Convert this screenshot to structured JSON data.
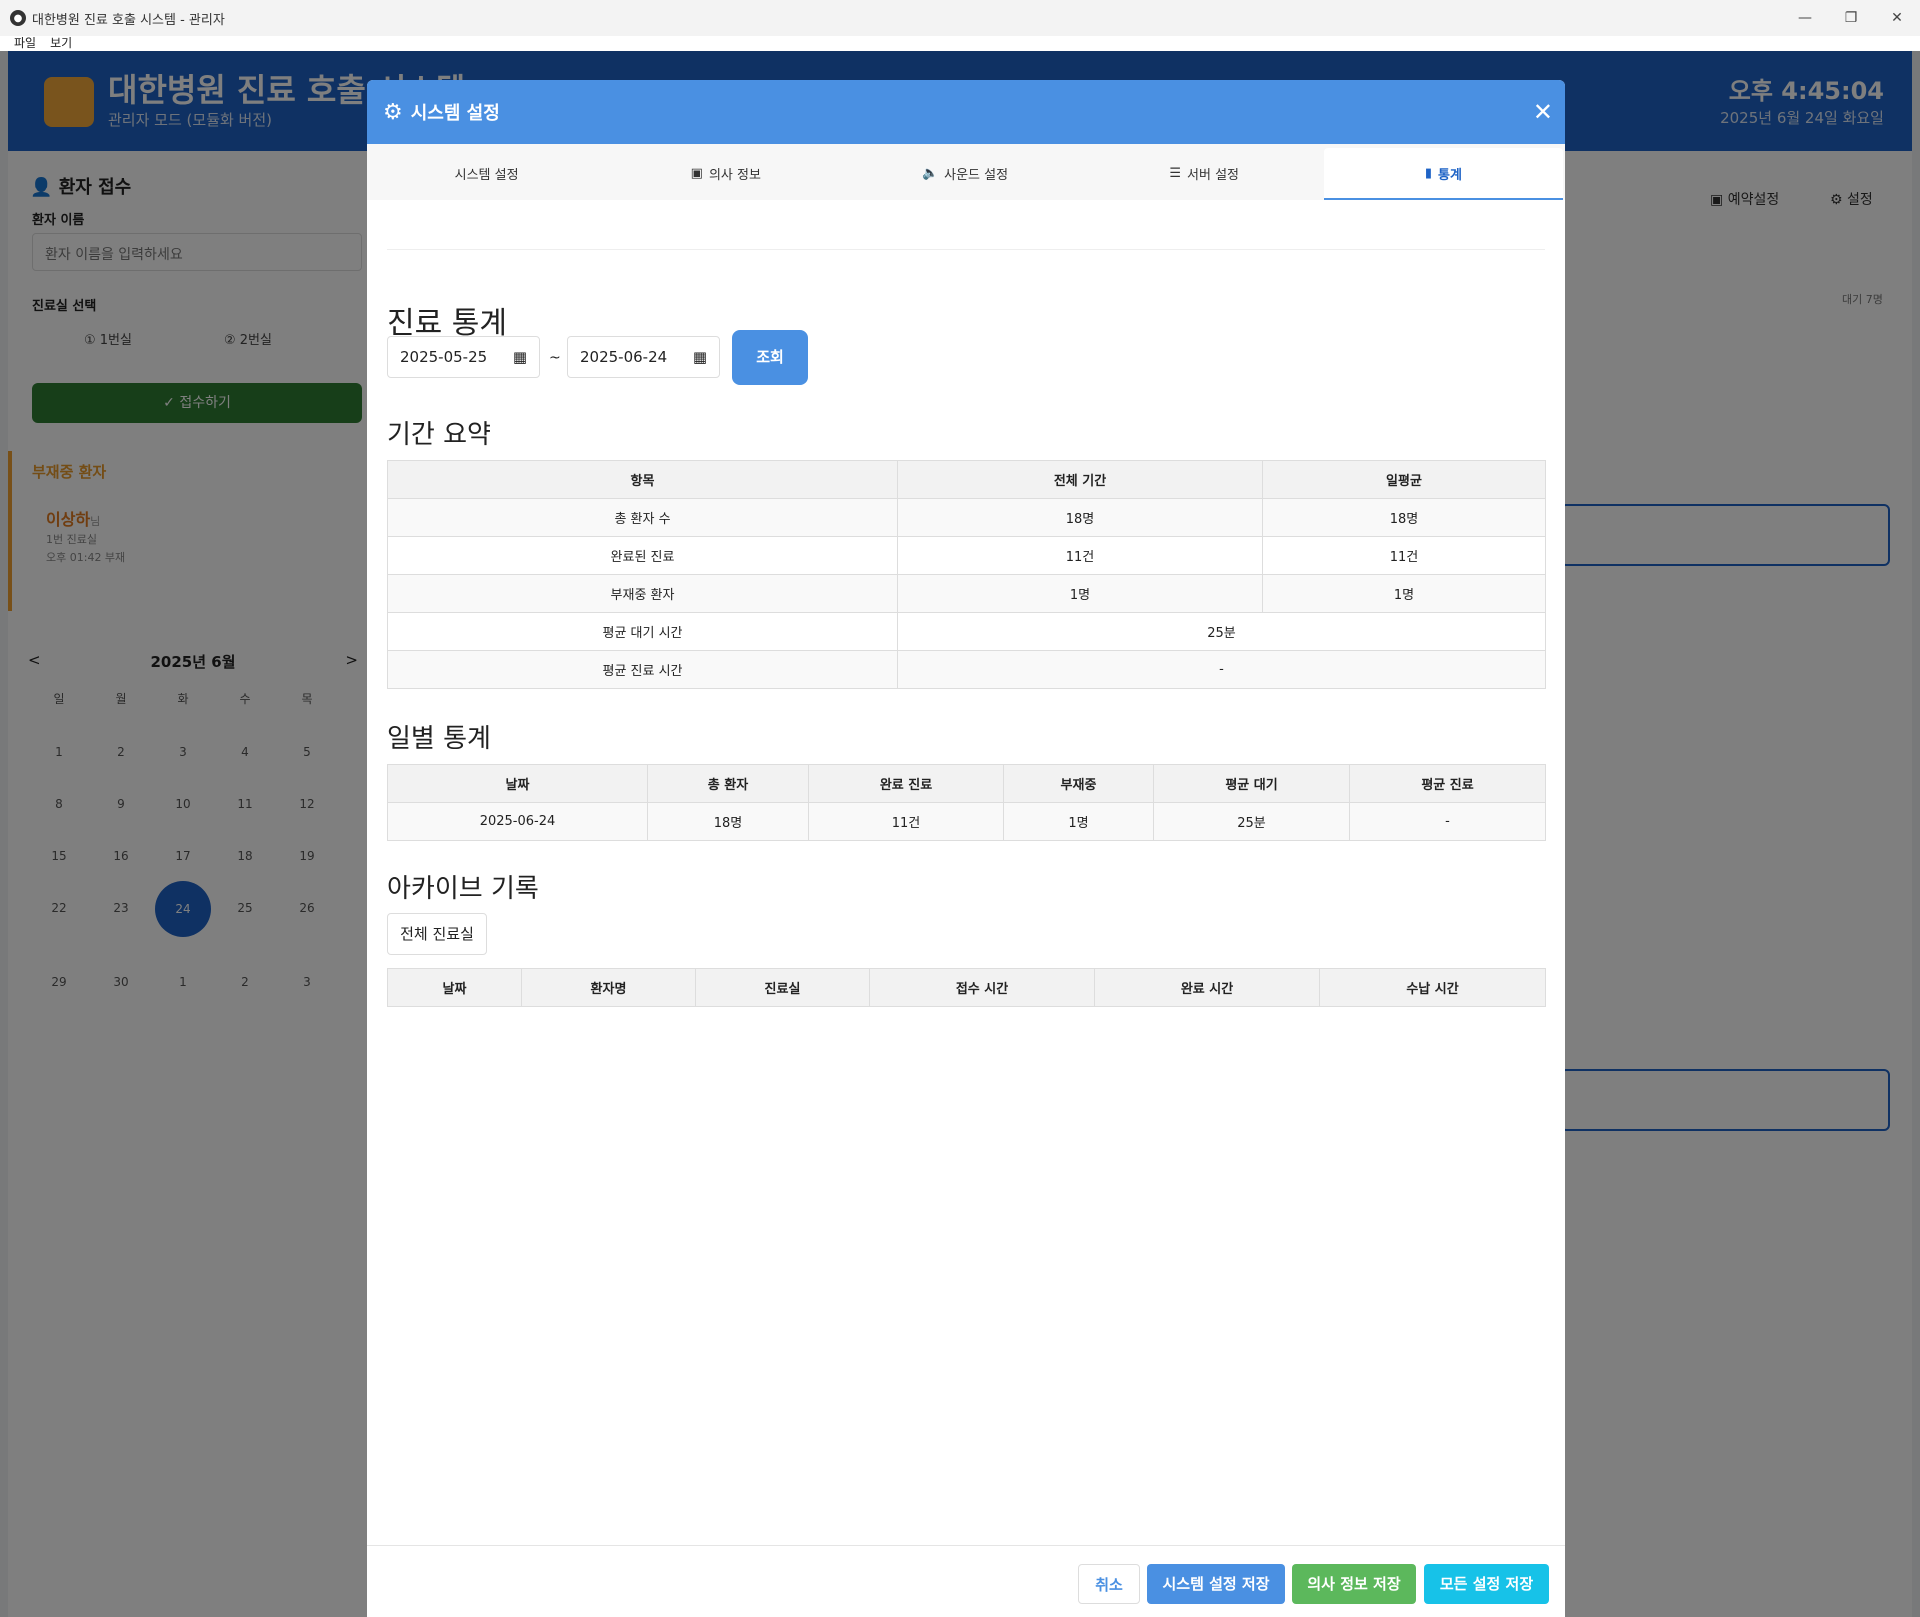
{
  "window": {
    "title": "대한병원 진료 호출 시스템 - 관리자",
    "menu": [
      "파일",
      "보기"
    ],
    "controls": [
      "minimize",
      "restore",
      "close"
    ]
  },
  "app": {
    "title": "대한병원 진료 호출 시스템",
    "subtitle": "관리자 모드 (모듈화 버전)",
    "clock": "오후 4:45:04",
    "date": "2025년 6월 24일 화요일"
  },
  "left": {
    "title": "환자 접수",
    "name_label": "환자 이름",
    "name_placeholder": "환자 이름을 입력하세요",
    "room_label": "진료실 선택",
    "rooms": [
      "① 1번실",
      "② 2번실"
    ],
    "register": "✓ 접수하기",
    "absent_title": "부재중 환자",
    "absent_name": "이상하",
    "absent_suffix": "님",
    "absent_room": "1번 진료실",
    "absent_time": "오후 01:42 부재",
    "cal_title": "2025년 6월",
    "cal_prev": "<",
    "cal_next": ">",
    "weekdays": [
      "일",
      "월",
      "화",
      "수",
      "목"
    ],
    "days": [
      "1",
      "2",
      "3",
      "4",
      "5",
      "8",
      "9",
      "10",
      "11",
      "12",
      "15",
      "16",
      "17",
      "18",
      "19",
      "22",
      "23",
      "24",
      "25",
      "26",
      "29",
      "30",
      "1",
      "2",
      "3"
    ]
  },
  "right": {
    "reserve": "예약설정",
    "settings": "설정",
    "wait": "대기 7명"
  },
  "modal": {
    "title": "시스템 설정",
    "tabs": [
      {
        "label": "시스템 설정",
        "icon": ""
      },
      {
        "label": "의사 정보",
        "icon": "id-card-icon"
      },
      {
        "label": "사운드 설정",
        "icon": "speaker-icon"
      },
      {
        "label": "서버 설정",
        "icon": "database-icon"
      },
      {
        "label": "통계",
        "icon": "bar-chart-icon"
      }
    ],
    "heading": "진료 통계",
    "from": "2025-05-25",
    "to": "2025-06-24",
    "tilde": "~",
    "search": "조회",
    "summary_title": "기간 요약",
    "summary_headers": [
      "항목",
      "전체 기간",
      "일평균"
    ],
    "summary_rows": [
      [
        "총 환자 수",
        "18명",
        "18명"
      ],
      [
        "완료된 진료",
        "11건",
        "11건"
      ],
      [
        "부재중 환자",
        "1명",
        "1명"
      ],
      [
        "평균 대기 시간",
        "25분"
      ],
      [
        "평균 진료 시간",
        "-"
      ]
    ],
    "daily_title": "일별 통계",
    "daily_headers": [
      "날짜",
      "총 환자",
      "완료 진료",
      "부재중",
      "평균 대기",
      "평균 진료"
    ],
    "daily_rows": [
      [
        "2025-06-24",
        "18명",
        "11건",
        "1명",
        "25분",
        "-"
      ]
    ],
    "archive_title": "아카이브 기록",
    "archive_filter": "전체 진료실",
    "archive_headers": [
      "날짜",
      "환자명",
      "진료실",
      "접수 시간",
      "완료 시간",
      "수납 시간"
    ],
    "buttons": {
      "cancel": "취소",
      "save_system": "시스템 설정 저장",
      "save_doctor": "의사 정보 저장",
      "save_all": "모든 설정 저장"
    },
    "colors": {
      "header": "#4a90e2",
      "save_system": "#4a90e2",
      "save_doctor": "#5cb85c",
      "save_all": "#17c2e8"
    }
  }
}
